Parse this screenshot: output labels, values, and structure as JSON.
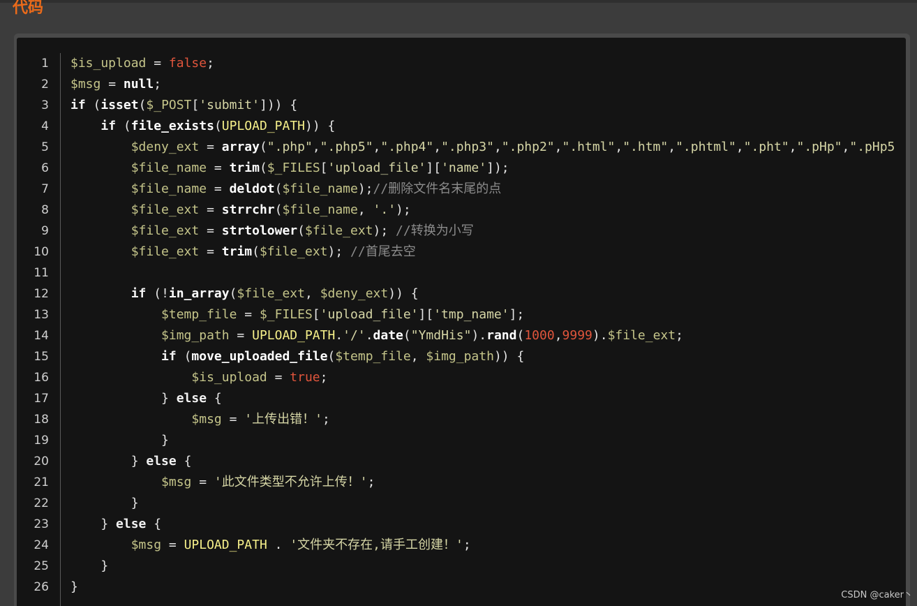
{
  "section": {
    "title": "代码"
  },
  "code": {
    "line_numbers": [
      "1",
      "2",
      "3",
      "4",
      "5",
      "6",
      "7",
      "8",
      "9",
      "10",
      "11",
      "12",
      "13",
      "14",
      "15",
      "16",
      "17",
      "18",
      "19",
      "20",
      "21",
      "22",
      "23",
      "24",
      "25",
      "26"
    ],
    "lines": [
      [
        [
          "var",
          "$is_upload"
        ],
        [
          "op",
          " = "
        ],
        [
          "bool",
          "false"
        ],
        [
          "op",
          ";"
        ]
      ],
      [
        [
          "var",
          "$msg"
        ],
        [
          "op",
          " = "
        ],
        [
          "fn",
          "null"
        ],
        [
          "op",
          ";"
        ]
      ],
      [
        [
          "kw",
          "if"
        ],
        [
          "op",
          " ("
        ],
        [
          "fn",
          "isset"
        ],
        [
          "op",
          "("
        ],
        [
          "var",
          "$_POST"
        ],
        [
          "op",
          "["
        ],
        [
          "str",
          "'submit'"
        ],
        [
          "op",
          "])) {"
        ]
      ],
      [
        [
          "op",
          "    "
        ],
        [
          "kw",
          "if"
        ],
        [
          "op",
          " ("
        ],
        [
          "fn",
          "file_exists"
        ],
        [
          "op",
          "("
        ],
        [
          "const",
          "UPLOAD_PATH"
        ],
        [
          "op",
          ")) {"
        ]
      ],
      [
        [
          "op",
          "        "
        ],
        [
          "var",
          "$deny_ext"
        ],
        [
          "op",
          " = "
        ],
        [
          "fn",
          "array"
        ],
        [
          "op",
          "("
        ],
        [
          "str",
          "\".php\""
        ],
        [
          "op",
          ","
        ],
        [
          "str",
          "\".php5\""
        ],
        [
          "op",
          ","
        ],
        [
          "str",
          "\".php4\""
        ],
        [
          "op",
          ","
        ],
        [
          "str",
          "\".php3\""
        ],
        [
          "op",
          ","
        ],
        [
          "str",
          "\".php2\""
        ],
        [
          "op",
          ","
        ],
        [
          "str",
          "\".html\""
        ],
        [
          "op",
          ","
        ],
        [
          "str",
          "\".htm\""
        ],
        [
          "op",
          ","
        ],
        [
          "str",
          "\".phtml\""
        ],
        [
          "op",
          ","
        ],
        [
          "str",
          "\".pht\""
        ],
        [
          "op",
          ","
        ],
        [
          "str",
          "\".pHp\""
        ],
        [
          "op",
          ","
        ],
        [
          "str",
          "\".pHp5"
        ]
      ],
      [
        [
          "op",
          "        "
        ],
        [
          "var",
          "$file_name"
        ],
        [
          "op",
          " = "
        ],
        [
          "fn",
          "trim"
        ],
        [
          "op",
          "("
        ],
        [
          "var",
          "$_FILES"
        ],
        [
          "op",
          "["
        ],
        [
          "str",
          "'upload_file'"
        ],
        [
          "op",
          "]["
        ],
        [
          "str",
          "'name'"
        ],
        [
          "op",
          "]);"
        ]
      ],
      [
        [
          "op",
          "        "
        ],
        [
          "var",
          "$file_name"
        ],
        [
          "op",
          " = "
        ],
        [
          "fn",
          "deldot"
        ],
        [
          "op",
          "("
        ],
        [
          "var",
          "$file_name"
        ],
        [
          "op",
          ");"
        ],
        [
          "cmt",
          "//删除文件名末尾的点"
        ]
      ],
      [
        [
          "op",
          "        "
        ],
        [
          "var",
          "$file_ext"
        ],
        [
          "op",
          " = "
        ],
        [
          "fn",
          "strrchr"
        ],
        [
          "op",
          "("
        ],
        [
          "var",
          "$file_name"
        ],
        [
          "op",
          ", "
        ],
        [
          "str",
          "'.'"
        ],
        [
          "op",
          ");"
        ]
      ],
      [
        [
          "op",
          "        "
        ],
        [
          "var",
          "$file_ext"
        ],
        [
          "op",
          " = "
        ],
        [
          "fn",
          "strtolower"
        ],
        [
          "op",
          "("
        ],
        [
          "var",
          "$file_ext"
        ],
        [
          "op",
          "); "
        ],
        [
          "cmt",
          "//转换为小写"
        ]
      ],
      [
        [
          "op",
          "        "
        ],
        [
          "var",
          "$file_ext"
        ],
        [
          "op",
          " = "
        ],
        [
          "fn",
          "trim"
        ],
        [
          "op",
          "("
        ],
        [
          "var",
          "$file_ext"
        ],
        [
          "op",
          "); "
        ],
        [
          "cmt",
          "//首尾去空"
        ]
      ],
      [],
      [
        [
          "op",
          "        "
        ],
        [
          "kw",
          "if"
        ],
        [
          "op",
          " (!"
        ],
        [
          "fn",
          "in_array"
        ],
        [
          "op",
          "("
        ],
        [
          "var",
          "$file_ext"
        ],
        [
          "op",
          ", "
        ],
        [
          "var",
          "$deny_ext"
        ],
        [
          "op",
          ")) {"
        ]
      ],
      [
        [
          "op",
          "            "
        ],
        [
          "var",
          "$temp_file"
        ],
        [
          "op",
          " = "
        ],
        [
          "var",
          "$_FILES"
        ],
        [
          "op",
          "["
        ],
        [
          "str",
          "'upload_file'"
        ],
        [
          "op",
          "]["
        ],
        [
          "str",
          "'tmp_name'"
        ],
        [
          "op",
          "];"
        ]
      ],
      [
        [
          "op",
          "            "
        ],
        [
          "var",
          "$img_path"
        ],
        [
          "op",
          " = "
        ],
        [
          "const",
          "UPLOAD_PATH"
        ],
        [
          "op",
          "."
        ],
        [
          "str",
          "'/'"
        ],
        [
          "op",
          "."
        ],
        [
          "fn",
          "date"
        ],
        [
          "op",
          "("
        ],
        [
          "str",
          "\"YmdHis\""
        ],
        [
          "op",
          ")."
        ],
        [
          "fn",
          "rand"
        ],
        [
          "op",
          "("
        ],
        [
          "num",
          "1000"
        ],
        [
          "op",
          ","
        ],
        [
          "num",
          "9999"
        ],
        [
          "op",
          ")."
        ],
        [
          "var",
          "$file_ext"
        ],
        [
          "op",
          ";"
        ]
      ],
      [
        [
          "op",
          "            "
        ],
        [
          "kw",
          "if"
        ],
        [
          "op",
          " ("
        ],
        [
          "fn",
          "move_uploaded_file"
        ],
        [
          "op",
          "("
        ],
        [
          "var",
          "$temp_file"
        ],
        [
          "op",
          ", "
        ],
        [
          "var",
          "$img_path"
        ],
        [
          "op",
          ")) {"
        ]
      ],
      [
        [
          "op",
          "                "
        ],
        [
          "var",
          "$is_upload"
        ],
        [
          "op",
          " = "
        ],
        [
          "bool",
          "true"
        ],
        [
          "op",
          ";"
        ]
      ],
      [
        [
          "op",
          "            } "
        ],
        [
          "kw",
          "else"
        ],
        [
          "op",
          " {"
        ]
      ],
      [
        [
          "op",
          "                "
        ],
        [
          "var",
          "$msg"
        ],
        [
          "op",
          " = "
        ],
        [
          "str",
          "'上传出错！'"
        ],
        [
          "op",
          ";"
        ]
      ],
      [
        [
          "op",
          "            }"
        ]
      ],
      [
        [
          "op",
          "        } "
        ],
        [
          "kw",
          "else"
        ],
        [
          "op",
          " {"
        ]
      ],
      [
        [
          "op",
          "            "
        ],
        [
          "var",
          "$msg"
        ],
        [
          "op",
          " = "
        ],
        [
          "str",
          "'此文件类型不允许上传！'"
        ],
        [
          "op",
          ";"
        ]
      ],
      [
        [
          "op",
          "        }"
        ]
      ],
      [
        [
          "op",
          "    } "
        ],
        [
          "kw",
          "else"
        ],
        [
          "op",
          " {"
        ]
      ],
      [
        [
          "op",
          "        "
        ],
        [
          "var",
          "$msg"
        ],
        [
          "op",
          " = "
        ],
        [
          "const",
          "UPLOAD_PATH"
        ],
        [
          "op",
          " . "
        ],
        [
          "str",
          "'文件夹不存在,请手工创建！'"
        ],
        [
          "op",
          ";"
        ]
      ],
      [
        [
          "op",
          "    }"
        ]
      ],
      [
        [
          "op",
          "}"
        ]
      ]
    ]
  },
  "watermark": {
    "text": "CSDN @caker丶"
  }
}
